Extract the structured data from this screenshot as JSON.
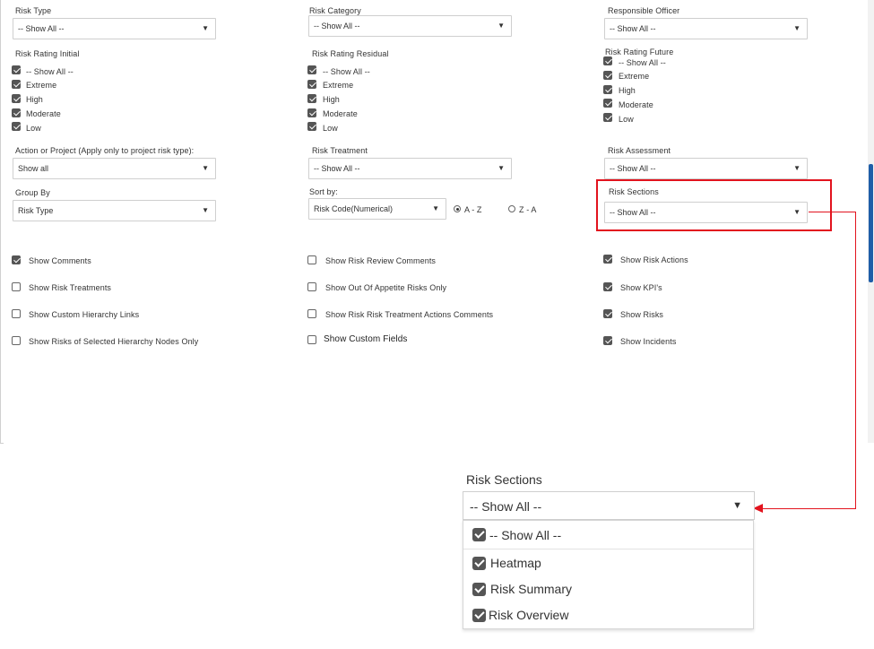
{
  "filters": {
    "risk_type": {
      "label": "Risk Type",
      "value": "-- Show All --"
    },
    "risk_category": {
      "label": "Risk Category",
      "value": "-- Show All --"
    },
    "responsible_officer": {
      "label": "Responsible Officer",
      "value": "-- Show All --"
    },
    "action_or_project": {
      "label": "Action or Project (Apply only to project risk type):",
      "value": "Show all"
    },
    "risk_treatment": {
      "label": "Risk Treatment",
      "value": "-- Show All --"
    },
    "risk_assessment": {
      "label": "Risk Assessment",
      "value": "-- Show All --"
    },
    "group_by": {
      "label": "Group By",
      "value": "Risk Type"
    },
    "sort_by": {
      "label": "Sort by:",
      "value": "Risk Code(Numerical)",
      "radio_az": "A - Z",
      "radio_za": "Z - A",
      "selected": "A - Z"
    },
    "risk_sections": {
      "label": "Risk Sections",
      "value": "-- Show All --"
    }
  },
  "ratings": {
    "initial": {
      "label": "Risk Rating Initial",
      "items": [
        "-- Show All --",
        "Extreme",
        "High",
        "Moderate",
        "Low"
      ]
    },
    "residual": {
      "label": "Risk Rating Residual",
      "items": [
        "-- Show All --",
        "Extreme",
        "High",
        "Moderate",
        "Low"
      ]
    },
    "future": {
      "label": "Risk Rating Future",
      "items": [
        "-- Show All --",
        "Extreme",
        "High",
        "Moderate",
        "Low"
      ]
    }
  },
  "options": {
    "col1": [
      {
        "label": "Show Comments",
        "checked": true
      },
      {
        "label": "Show Risk Treatments",
        "checked": false
      },
      {
        "label": "Show Custom Hierarchy Links",
        "checked": false
      },
      {
        "label": "Show Risks of Selected Hierarchy Nodes Only",
        "checked": false
      }
    ],
    "col2": [
      {
        "label": "Show Risk Review Comments",
        "checked": false
      },
      {
        "label": "Show Out Of Appetite Risks Only",
        "checked": false
      },
      {
        "label": "Show Risk Risk Treatment Actions Comments",
        "checked": false
      },
      {
        "label": "Show Custom Fields",
        "checked": false
      }
    ],
    "col3": [
      {
        "label": "Show Risk Actions",
        "checked": true
      },
      {
        "label": "Show KPI's",
        "checked": true
      },
      {
        "label": "Show Risks",
        "checked": true
      },
      {
        "label": "Show Incidents",
        "checked": true
      }
    ]
  },
  "zoom": {
    "title": "Risk Sections",
    "value": "-- Show All --",
    "options": [
      "-- Show All --",
      "Heatmap",
      "Risk Summary",
      "Risk Overview"
    ]
  },
  "colors": {
    "highlight": "#e2131e",
    "scroll_thumb": "#1f5ea8",
    "checkbox": "#555555"
  }
}
